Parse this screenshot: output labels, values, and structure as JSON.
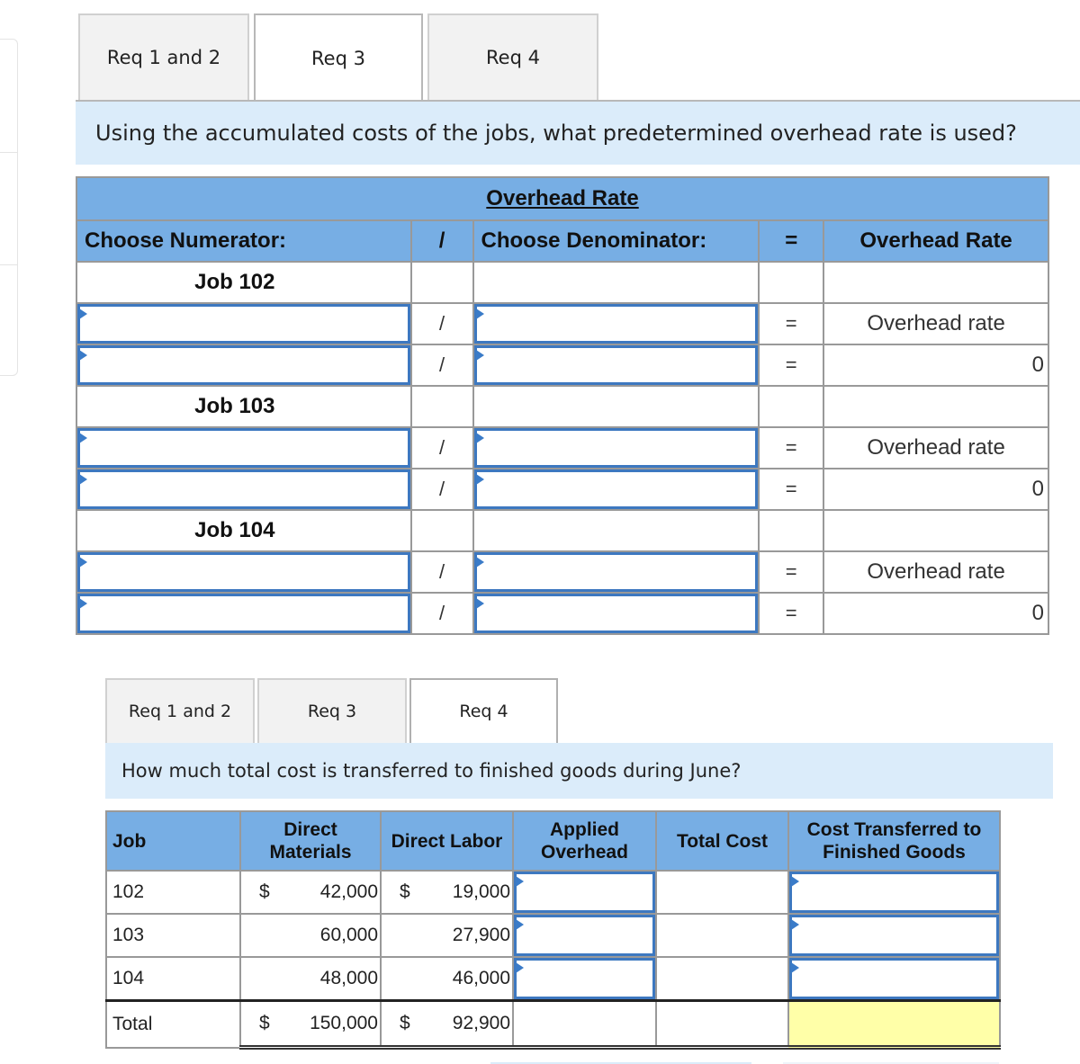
{
  "section1": {
    "tabs": [
      {
        "label": "Req 1 and 2",
        "active": false
      },
      {
        "label": "Req 3",
        "active": true
      },
      {
        "label": "Req 4",
        "active": false
      }
    ],
    "question": "Using the accumulated costs of the jobs, what predetermined overhead rate is used?",
    "table": {
      "title": "Overhead Rate",
      "headers": {
        "numerator": "Choose Numerator:",
        "divide": "/",
        "denominator": "Choose Denominator:",
        "equals": "=",
        "result": "Overhead Rate"
      },
      "operators": {
        "divide": "/",
        "equals": "="
      },
      "jobs": [
        {
          "label": "Job 102",
          "rows": [
            {
              "numerator": "",
              "denominator": "",
              "result": "Overhead rate"
            },
            {
              "numerator": "",
              "denominator": "",
              "result": "0"
            }
          ]
        },
        {
          "label": "Job 103",
          "rows": [
            {
              "numerator": "",
              "denominator": "",
              "result": "Overhead rate"
            },
            {
              "numerator": "",
              "denominator": "",
              "result": "0"
            }
          ]
        },
        {
          "label": "Job 104",
          "rows": [
            {
              "numerator": "",
              "denominator": "",
              "result": "Overhead rate"
            },
            {
              "numerator": "",
              "denominator": "",
              "result": "0"
            }
          ]
        }
      ]
    }
  },
  "section2": {
    "tabs": [
      {
        "label": "Req 1 and 2",
        "active": false
      },
      {
        "label": "Req 3",
        "active": false
      },
      {
        "label": "Req 4",
        "active": true
      }
    ],
    "question": "How much total cost is transferred to finished goods during June?",
    "table": {
      "headers": {
        "job": "Job",
        "direct_materials": "Direct Materials",
        "direct_labor": "Direct Labor",
        "applied_overhead": "Applied Overhead",
        "total_cost": "Total Cost",
        "transferred": "Cost Transferred to Finished Goods"
      },
      "currency": "$",
      "rows": [
        {
          "job": "102",
          "dm_symbol": "$",
          "direct_materials": "42,000",
          "dl_symbol": "$",
          "direct_labor": "19,000",
          "applied_overhead": "",
          "total_cost": "",
          "transferred": ""
        },
        {
          "job": "103",
          "dm_symbol": "",
          "direct_materials": "60,000",
          "dl_symbol": "",
          "direct_labor": "27,900",
          "applied_overhead": "",
          "total_cost": "",
          "transferred": ""
        },
        {
          "job": "104",
          "dm_symbol": "",
          "direct_materials": "48,000",
          "dl_symbol": "",
          "direct_labor": "46,000",
          "applied_overhead": "",
          "total_cost": "",
          "transferred": ""
        }
      ],
      "total": {
        "label": "Total",
        "dm_symbol": "$",
        "direct_materials": "150,000",
        "dl_symbol": "$",
        "direct_labor": "92,900",
        "applied_overhead": "",
        "total_cost": "",
        "transferred": ""
      }
    }
  },
  "colors": {
    "header_blue": "#77aee4",
    "question_bg": "#dbecfa",
    "input_border": "#3d78c0",
    "total_highlight": "#ffffa8"
  }
}
